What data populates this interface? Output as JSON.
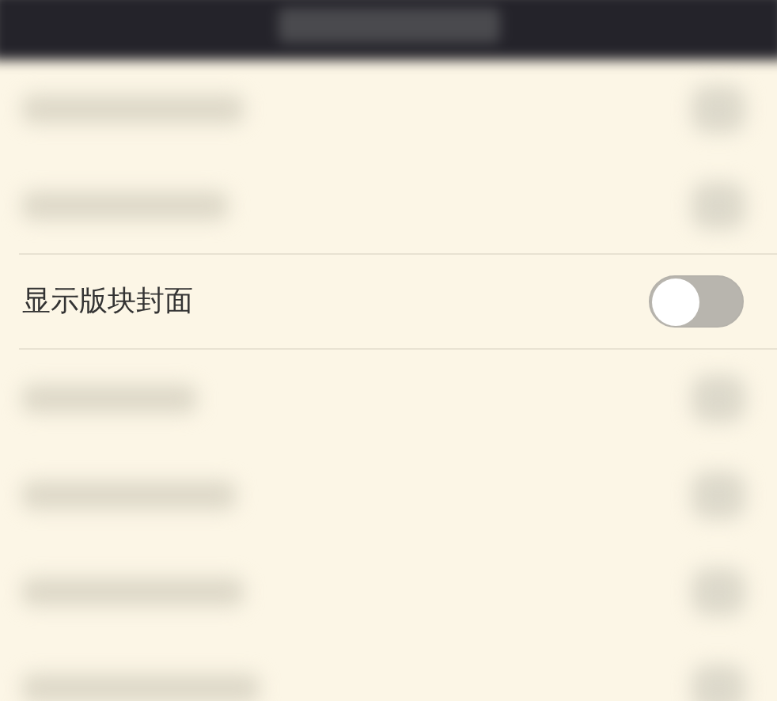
{
  "setting": {
    "label": "显示版块封面",
    "on": false
  }
}
